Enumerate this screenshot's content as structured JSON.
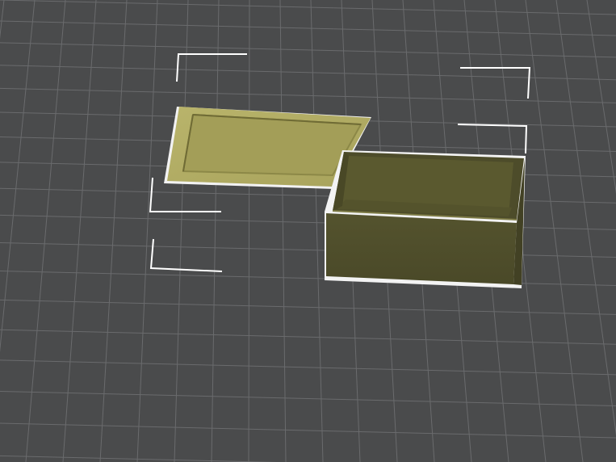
{
  "viewport": {
    "background": "#4a4b4c",
    "grid_color": "#6a6b6d",
    "grid_major_color": "#8a8b8d"
  },
  "scene": {
    "objects": [
      {
        "name": "lid",
        "color": "#bfba6a",
        "shade": "#8f8b45"
      },
      {
        "name": "box",
        "color": "#4f4e2c",
        "shade": "#3f3e22"
      }
    ],
    "selection_color": "#ffffff"
  }
}
